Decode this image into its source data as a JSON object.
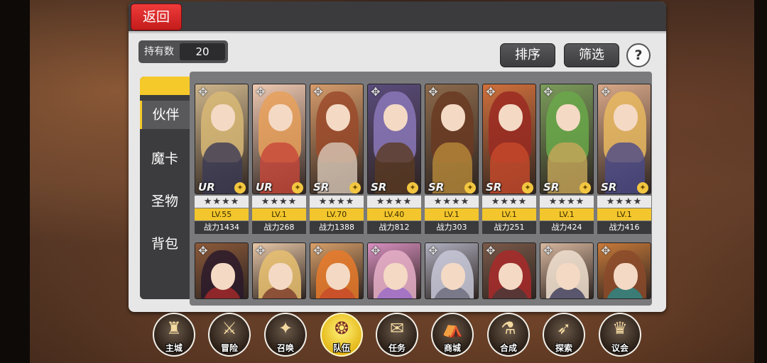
{
  "header": {
    "back_label": "返回"
  },
  "owned": {
    "label": "持有数",
    "value": "20"
  },
  "actions": {
    "sort_label": "排序",
    "filter_label": "筛选",
    "help_label": "?"
  },
  "side_tabs": [
    {
      "label": "伙伴",
      "active": true
    },
    {
      "label": "魔卡",
      "active": false
    },
    {
      "label": "圣物",
      "active": false
    },
    {
      "label": "背包",
      "active": false
    }
  ],
  "cards_row1": [
    {
      "rarity": "UR",
      "stars": "★★★★",
      "level": "LV.55",
      "power": "战力1434",
      "hair": "#d8b876",
      "body": "#3b3a55",
      "bg": "#cdb58c"
    },
    {
      "rarity": "UR",
      "stars": "★★★★",
      "level": "LV.1",
      "power": "战力268",
      "hair": "#e8a05a",
      "body": "#c8463a",
      "bg": "#efc9b2"
    },
    {
      "rarity": "SR",
      "stars": "★★★★",
      "level": "LV.70",
      "power": "战力1388",
      "hair": "#9a4a2a",
      "body": "#d8c8b8",
      "bg": "#d69c6c"
    },
    {
      "rarity": "SR",
      "stars": "★★★★",
      "level": "LV.40",
      "power": "战力812",
      "hair": "#8a78b8",
      "body": "#5a3a22",
      "bg": "#5a4c7c"
    },
    {
      "rarity": "SR",
      "stars": "★★★★",
      "level": "LV.1",
      "power": "战力303",
      "hair": "#6a3a22",
      "body": "#b88a3a",
      "bg": "#8c6a4c"
    },
    {
      "rarity": "SR",
      "stars": "★★★★",
      "level": "LV.1",
      "power": "战力251",
      "hair": "#9a2a22",
      "body": "#c84a2a",
      "bg": "#d0703c"
    },
    {
      "rarity": "SR",
      "stars": "★★★★",
      "level": "LV.1",
      "power": "战力424",
      "hair": "#6aa84a",
      "body": "#c8a85a",
      "bg": "#7c9c5c"
    },
    {
      "rarity": "SR",
      "stars": "★★★★",
      "level": "LV.1",
      "power": "战力416",
      "hair": "#e8b860",
      "body": "#4a4a8a",
      "bg": "#d8a888"
    }
  ],
  "cards_row2": [
    {
      "hair": "#2a1a2a",
      "body": "#a82a2a",
      "bg": "#8c5a3a"
    },
    {
      "hair": "#e8c070",
      "body": "#7a3a2a",
      "bg": "#e8c8a8"
    },
    {
      "hair": "#e87a2a",
      "body": "#c84a2a",
      "bg": "#d8a06a"
    },
    {
      "hair": "#e8b0c8",
      "body": "#9a6ac8",
      "bg": "#d890c0"
    },
    {
      "hair": "#c8c8d8",
      "body": "#6a6a7a",
      "bg": "#b0b0c0"
    },
    {
      "hair": "#a82a2a",
      "body": "#4a3a3a",
      "bg": "#7a5a4a"
    },
    {
      "hair": "#f0e0d0",
      "body": "#3a3a5a",
      "bg": "#d8b8a0"
    },
    {
      "hair": "#8a4a2a",
      "body": "#2a8a8a",
      "bg": "#c87a3a"
    }
  ],
  "nav": [
    {
      "label": "主城",
      "icon": "castle-icon",
      "glyph": "♜",
      "active": false
    },
    {
      "label": "冒险",
      "icon": "crossed-axes-icon",
      "glyph": "⚔",
      "active": false
    },
    {
      "label": "召唤",
      "icon": "summon-cards-icon",
      "glyph": "✦",
      "active": false
    },
    {
      "label": "队伍",
      "icon": "team-emblem-icon",
      "glyph": "❂",
      "active": true
    },
    {
      "label": "任务",
      "icon": "quest-scroll-icon",
      "glyph": "✉",
      "active": false
    },
    {
      "label": "商城",
      "icon": "shop-tent-icon",
      "glyph": "⛺",
      "active": false
    },
    {
      "label": "合成",
      "icon": "synthesis-flask-icon",
      "glyph": "⚗",
      "active": false
    },
    {
      "label": "探索",
      "icon": "explore-bow-icon",
      "glyph": "➶",
      "active": false
    },
    {
      "label": "议会",
      "icon": "council-hall-icon",
      "glyph": "♛",
      "active": false
    }
  ]
}
